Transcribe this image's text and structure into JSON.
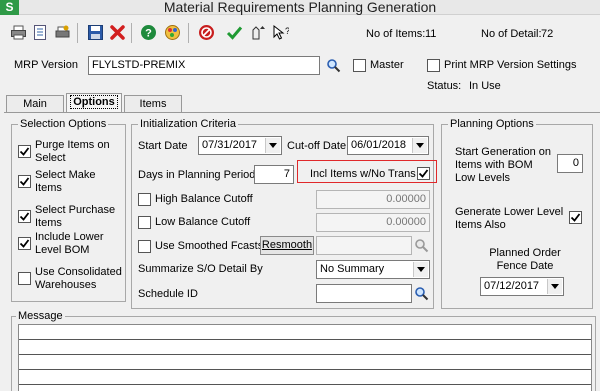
{
  "window": {
    "app_letter": "S",
    "title": "Material Requirements Planning Generation"
  },
  "toolbar": {
    "icons": [
      "print-icon",
      "print-preview-icon",
      "print-setup-icon",
      "save-icon",
      "delete-icon",
      "help-icon",
      "color-palette-icon",
      "stop-icon",
      "accept-icon",
      "inquiry-icon",
      "help-pointer-icon"
    ]
  },
  "header": {
    "no_of_items_label": "No of Items:",
    "no_of_items_value": "11",
    "no_of_detail_label": "No of Detail:",
    "no_of_detail_value": "72",
    "mrp_version_label": "MRP Version",
    "mrp_version_value": "FLYLSTD-PREMIX",
    "master_label": "Master",
    "master_checked": false,
    "print_settings_label": "Print MRP Version Settings",
    "print_settings_checked": false,
    "status_label": "Status:",
    "status_value": "In Use"
  },
  "tabs": [
    {
      "label": "Main",
      "active": false
    },
    {
      "label": "Options",
      "active": true
    },
    {
      "label": "Items",
      "active": false
    }
  ],
  "selection_options": {
    "title": "Selection Options",
    "items": [
      {
        "label": "Purge Items on Select",
        "checked": true
      },
      {
        "label": "Select Make Items",
        "checked": true
      },
      {
        "label": "Select Purchase Items",
        "checked": true
      },
      {
        "label": "Include Lower Level BOM",
        "checked": true
      },
      {
        "label": "Use Consolidated Warehouses",
        "checked": false
      }
    ]
  },
  "init": {
    "title": "Initialization Criteria",
    "start_date_label": "Start Date",
    "start_date_value": "07/31/2017",
    "cutoff_date_label": "Cut-off Date",
    "cutoff_date_value": "06/01/2018",
    "days_label": "Days in Planning Period",
    "days_value": "7",
    "incl_label": "Incl Items w/No Trans",
    "incl_checked": true,
    "high_balance_label": "High Balance Cutoff",
    "high_balance_value": "0.00000",
    "low_balance_label": "Low Balance Cutoff",
    "low_balance_value": "0.00000",
    "smoothed_label": "Use Smoothed Fcasts",
    "resmooth_label": "Resmooth",
    "summarize_label": "Summarize S/O Detail By",
    "summarize_value": "No Summary",
    "schedule_label": "Schedule ID",
    "schedule_value": ""
  },
  "planning": {
    "title": "Planning Options",
    "start_gen_label": "Start Generation on Items with BOM Low Levels",
    "start_gen_value": "0",
    "gen_lower_label": "Generate Lower Level Items  Also",
    "gen_lower_checked": true,
    "fence_label": "Planned Order Fence Date",
    "fence_value": "07/12/2017"
  },
  "message": {
    "title": "Message"
  },
  "colors": {
    "highlight_box": "#e0282a",
    "logo_green": "#2f9a47"
  }
}
